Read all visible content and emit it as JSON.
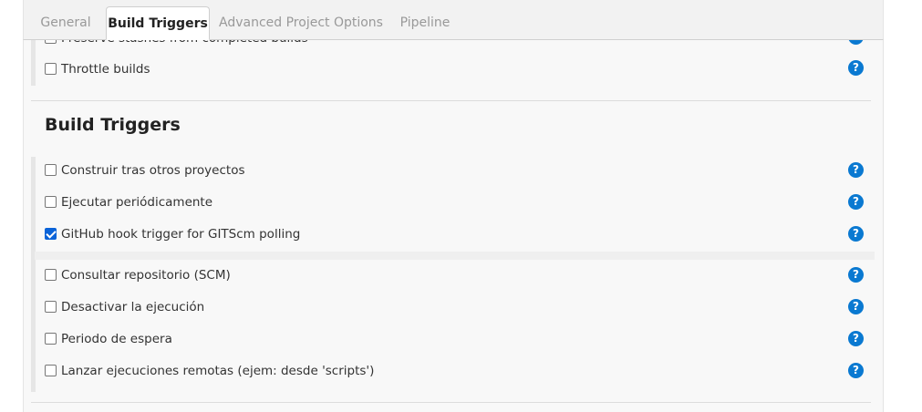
{
  "tabs": [
    "General",
    "Build Triggers",
    "Advanced Project Options",
    "Pipeline"
  ],
  "active_tab": "Build Triggers",
  "top_options": [
    {
      "label": "Preserve stashes from completed builds",
      "checked": false
    },
    {
      "label": "Throttle builds",
      "checked": false
    }
  ],
  "section_title": "Build Triggers",
  "triggers": [
    {
      "label": "Construir tras otros proyectos",
      "checked": false
    },
    {
      "label": "Ejecutar periódicamente",
      "checked": false
    },
    {
      "label": "GitHub hook trigger for GITScm polling",
      "checked": true
    },
    {
      "label": "Consultar repositorio (SCM)",
      "checked": false
    },
    {
      "label": "Desactivar la ejecución",
      "checked": false
    },
    {
      "label": "Periodo de espera",
      "checked": false
    },
    {
      "label": "Lanzar ejecuciones remotas (ejem: desde 'scripts')",
      "checked": false
    }
  ],
  "help_glyph": "?",
  "colors": {
    "help": "#0a79d1",
    "checkbox_checked": "#0a63d8"
  }
}
